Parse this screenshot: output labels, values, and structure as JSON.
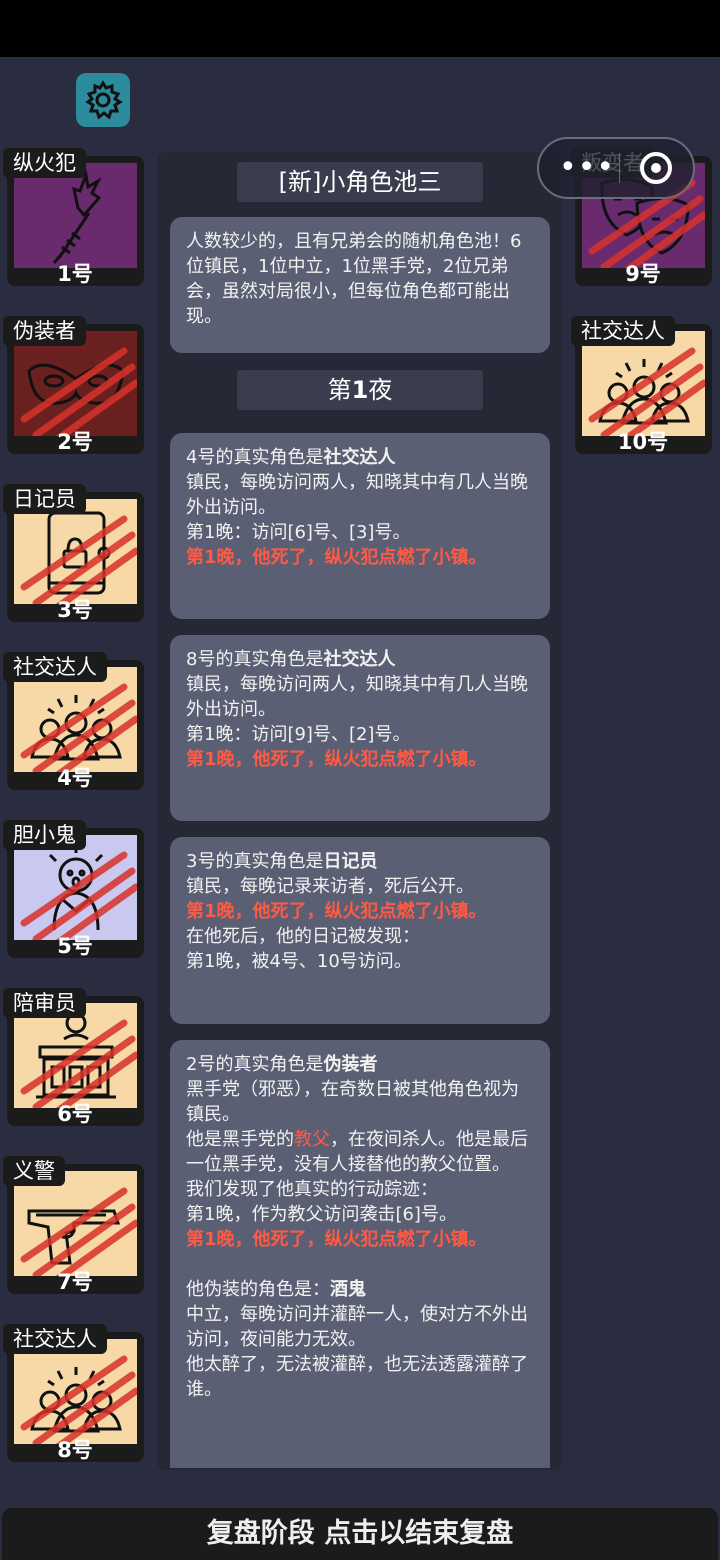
{
  "settings": {
    "icon": "gear-icon"
  },
  "capsule": {
    "more": "•••",
    "close_icon": "target-icon"
  },
  "players_left": [
    {
      "name": "纵火犯",
      "num": "1号",
      "bg": "#6a2a6e",
      "icon": "torch-icon",
      "dead": false
    },
    {
      "name": "伪装者",
      "num": "2号",
      "bg": "#6b2020",
      "icon": "mask-icon",
      "dead": true
    },
    {
      "name": "日记员",
      "num": "3号",
      "bg": "#f6d9a6",
      "icon": "diary-icon",
      "dead": true
    },
    {
      "name": "社交达人",
      "num": "4号",
      "bg": "#f6d9a6",
      "icon": "crowd-icon",
      "dead": true
    },
    {
      "name": "胆小鬼",
      "num": "5号",
      "bg": "#c9c9f0",
      "icon": "coward-icon",
      "dead": true
    },
    {
      "name": "陪审员",
      "num": "6号",
      "bg": "#f6d9a6",
      "icon": "court-icon",
      "dead": true
    },
    {
      "name": "义警",
      "num": "7号",
      "bg": "#f6d9a6",
      "icon": "gun-icon",
      "dead": true
    },
    {
      "name": "社交达人",
      "num": "8号",
      "bg": "#f6d9a6",
      "icon": "crowd-icon",
      "dead": true
    }
  ],
  "players_right": [
    {
      "name": "叛变者",
      "num": "9号",
      "bg": "#6a2a6e",
      "icon": "drama-mask-icon",
      "dead": true
    },
    {
      "name": "社交达人",
      "num": "10号",
      "bg": "#f6d9a6",
      "icon": "crowd-icon",
      "dead": true
    }
  ],
  "pool_title": "[新]小角色池三",
  "pool_desc": "人数较少的，且有兄弟会的随机角色池！6位镇民，1位中立，1位黑手党，2位兄弟会，虽然对局很小，但每位角色都可能出现。",
  "night_title_prefix": "第",
  "night_title_num": "1",
  "night_title_suffix": "夜",
  "reports": [
    {
      "title_pre": "4号的真实角色是",
      "title_role": "社交达人",
      "desc": "镇民，每晚访问两人，知晓其中有几人当晚外出访问。",
      "visit": "第1晚：访问[6]号、[3]号。",
      "death": "第1晚，他死了，纵火犯点燃了小镇。"
    },
    {
      "title_pre": "8号的真实角色是",
      "title_role": "社交达人",
      "desc": "镇民，每晚访问两人，知晓其中有几人当晚外出访问。",
      "visit": "第1晚：访问[9]号、[2]号。",
      "death": "第1晚，他死了，纵火犯点燃了小镇。"
    },
    {
      "title_pre": "3号的真实角色是",
      "title_role": "日记员",
      "desc": "镇民，每晚记录来访者，死后公开。",
      "death": "第1晚，他死了，纵火犯点燃了小镇。",
      "after1": "在他死后，他的日记被发现：",
      "after2": "第1晚，被4号、10号访问。"
    },
    {
      "title_pre": "2号的真实角色是",
      "title_role": "伪装者",
      "desc": "黑手党（邪恶），在奇数日被其他角色视为镇民。",
      "gf_pre": "他是黑手党的",
      "gf_role": "教父",
      "gf_post": "，在夜间杀人。他是最后一位黑手党，没有人接替他的教父位置。",
      "trace": "我们发现了他真实的行动踪迹：",
      "trace_visit": "第1晚，作为教父访问袭击[6]号。",
      "death": "第1晚，他死了，纵火犯点燃了小镇。",
      "disguise_pre": "他伪装的角色是：",
      "disguise_role": "酒鬼",
      "disguise_desc": "中立，每晚访问并灌醉一人，使对方不外出访问，夜间能力无效。",
      "disguise_note": "他太醉了，无法被灌醉，也无法透露灌醉了谁。"
    }
  ],
  "bottom_text": "复盘阶段 点击以结束复盘"
}
